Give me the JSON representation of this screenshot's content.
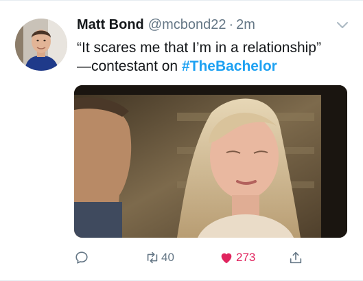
{
  "tweet": {
    "author": {
      "display_name": "Matt Bond",
      "handle": "@mcbond22"
    },
    "separator": "·",
    "timestamp": "2m",
    "text": {
      "line1": "“It scares me that I’m in a relationship”",
      "line2_prefix": "—contestant on ",
      "hashtag": "#TheBachelor"
    },
    "actions": {
      "reply_icon": "reply-icon",
      "retweet_icon": "retweet-icon",
      "retweet_count": "40",
      "like_icon": "heart-icon",
      "like_count": "273",
      "share_icon": "share-icon"
    }
  },
  "colors": {
    "link": "#1da1f2",
    "secondary": "#657786",
    "like": "#e0245e",
    "text": "#14171a"
  }
}
